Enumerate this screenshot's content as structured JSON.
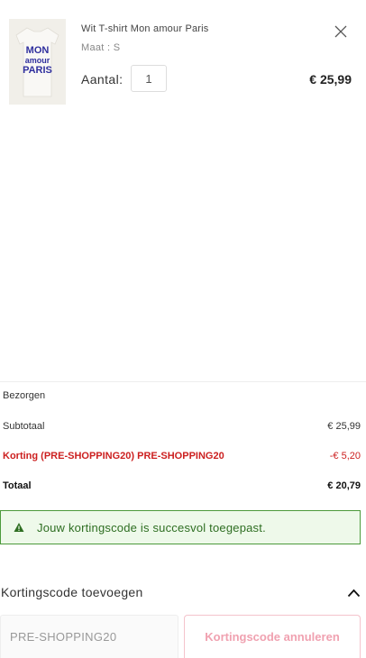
{
  "item": {
    "name": "Wit T-shirt Mon amour Paris",
    "size": "Maat : S",
    "qty_label": "Aantal:",
    "qty_value": "1",
    "price": "€ 25,99",
    "image_text": [
      "MON",
      "amour",
      "PARIS"
    ]
  },
  "totals": {
    "shipping_label": "Bezorgen",
    "subtotal_label": "Subtotaal",
    "subtotal_value": "€ 25,99",
    "discount_label": "Korting (PRE-SHOPPING20) PRE-SHOPPING20",
    "discount_value": "-€ 5,20",
    "total_label": "Totaal",
    "total_value": "€ 20,79"
  },
  "alert": {
    "message": "Jouw kortingscode is succesvol toegepast."
  },
  "coupon": {
    "heading": "Kortingscode toevoegen",
    "input_value": "PRE-SHOPPING20",
    "cancel_label": "Kortingscode annuleren"
  },
  "colors": {
    "discount": "#cc1f1f",
    "success_bg": "#eef9ea",
    "success_border": "#4c9a3b",
    "cancel_text": "#f0a1b0"
  },
  "icons": {
    "close": "close-icon",
    "warning": "warning-icon",
    "chevron": "chevron-up-icon"
  }
}
